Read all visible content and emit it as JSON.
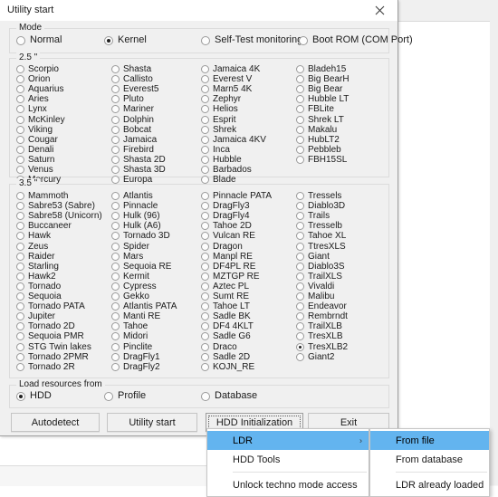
{
  "background": {
    "toolbar_glyphs": [
      "▮▮",
      "▦",
      "▬"
    ]
  },
  "dialog": {
    "title": "Utility start",
    "close_icon": "close-icon"
  },
  "mode_group": {
    "label": "Mode",
    "options": [
      {
        "label": "Normal",
        "checked": false
      },
      {
        "label": "Kernel",
        "checked": true
      },
      {
        "label": "Self-Test monitoring",
        "checked": false
      },
      {
        "label": "Boot ROM (COM Port)",
        "checked": false
      }
    ]
  },
  "group_25": {
    "label": "2.5 \"",
    "columns": [
      [
        {
          "label": "Scorpio",
          "checked": false
        },
        {
          "label": "Orion",
          "checked": false
        },
        {
          "label": "Aquarius",
          "checked": false
        },
        {
          "label": "Aries",
          "checked": false
        },
        {
          "label": "Lynx",
          "checked": false
        },
        {
          "label": "McKinley",
          "checked": false
        },
        {
          "label": "Viking",
          "checked": false
        },
        {
          "label": "Cougar",
          "checked": false
        },
        {
          "label": "Denali",
          "checked": false
        },
        {
          "label": "Saturn",
          "checked": false
        },
        {
          "label": "Venus",
          "checked": false
        },
        {
          "label": "Mercury",
          "checked": false
        }
      ],
      [
        {
          "label": "Shasta",
          "checked": false
        },
        {
          "label": "Callisto",
          "checked": false
        },
        {
          "label": "Everest5",
          "checked": false
        },
        {
          "label": "Pluto",
          "checked": false
        },
        {
          "label": "Mariner",
          "checked": false
        },
        {
          "label": "Dolphin",
          "checked": false
        },
        {
          "label": "Bobcat",
          "checked": false
        },
        {
          "label": "Jamaica",
          "checked": false
        },
        {
          "label": "Firebird",
          "checked": false
        },
        {
          "label": "Shasta 2D",
          "checked": false
        },
        {
          "label": "Shasta 3D",
          "checked": false
        },
        {
          "label": "Europa",
          "checked": false
        }
      ],
      [
        {
          "label": "Jamaica 4K",
          "checked": false
        },
        {
          "label": "Everest V",
          "checked": false
        },
        {
          "label": "Marn5 4K",
          "checked": false
        },
        {
          "label": "Zephyr",
          "checked": false
        },
        {
          "label": "Helios",
          "checked": false
        },
        {
          "label": "Esprit",
          "checked": false
        },
        {
          "label": "Shrek",
          "checked": false
        },
        {
          "label": "Jamaica 4KV",
          "checked": false
        },
        {
          "label": "Inca",
          "checked": false
        },
        {
          "label": "Hubble",
          "checked": false
        },
        {
          "label": "Barbados",
          "checked": false
        },
        {
          "label": "Blade",
          "checked": false
        }
      ],
      [
        {
          "label": "Bladeh15",
          "checked": false
        },
        {
          "label": "Big BearH",
          "checked": false
        },
        {
          "label": "Big Bear",
          "checked": false
        },
        {
          "label": "Hubble LT",
          "checked": false
        },
        {
          "label": "FBLite",
          "checked": false
        },
        {
          "label": "Shrek LT",
          "checked": false
        },
        {
          "label": "Makalu",
          "checked": false
        },
        {
          "label": "HubLT2",
          "checked": false
        },
        {
          "label": "Pebbleb",
          "checked": false
        },
        {
          "label": "FBH15SL",
          "checked": false
        }
      ]
    ]
  },
  "group_35": {
    "label": "3.5 \"",
    "columns": [
      [
        {
          "label": "Mammoth",
          "checked": false
        },
        {
          "label": "Sabre53 (Sabre)",
          "checked": false
        },
        {
          "label": "Sabre58 (Unicorn)",
          "checked": false
        },
        {
          "label": "Buccaneer",
          "checked": false
        },
        {
          "label": "Hawk",
          "checked": false
        },
        {
          "label": "Zeus",
          "checked": false
        },
        {
          "label": "Raider",
          "checked": false
        },
        {
          "label": "Starling",
          "checked": false
        },
        {
          "label": "Hawk2",
          "checked": false
        },
        {
          "label": "Tornado",
          "checked": false
        },
        {
          "label": "Sequoia",
          "checked": false
        },
        {
          "label": "Tornado PATA",
          "checked": false
        },
        {
          "label": "Jupiter",
          "checked": false
        },
        {
          "label": "Tornado 2D",
          "checked": false
        },
        {
          "label": "Sequoia PMR",
          "checked": false
        },
        {
          "label": "STG Twin lakes",
          "checked": false
        },
        {
          "label": "Tornado 2PMR",
          "checked": false
        },
        {
          "label": "Tornado 2R",
          "checked": false
        }
      ],
      [
        {
          "label": "Atlantis",
          "checked": false
        },
        {
          "label": "Pinnacle",
          "checked": false
        },
        {
          "label": "Hulk (96)",
          "checked": false
        },
        {
          "label": "Hulk (A6)",
          "checked": false
        },
        {
          "label": "Tornado 3D",
          "checked": false
        },
        {
          "label": "Spider",
          "checked": false
        },
        {
          "label": "Mars",
          "checked": false
        },
        {
          "label": "Sequoia RE",
          "checked": false
        },
        {
          "label": "Kermit",
          "checked": false
        },
        {
          "label": "Cypress",
          "checked": false
        },
        {
          "label": "Gekko",
          "checked": false
        },
        {
          "label": "Atlantis PATA",
          "checked": false
        },
        {
          "label": "Manti RE",
          "checked": false
        },
        {
          "label": "Tahoe",
          "checked": false
        },
        {
          "label": "Midori",
          "checked": false
        },
        {
          "label": "Pinclite",
          "checked": false
        },
        {
          "label": "DragFly1",
          "checked": false
        },
        {
          "label": "DragFly2",
          "checked": false
        }
      ],
      [
        {
          "label": "Pinnacle PATA",
          "checked": false
        },
        {
          "label": "DragFly3",
          "checked": false
        },
        {
          "label": "DragFly4",
          "checked": false
        },
        {
          "label": "Tahoe 2D",
          "checked": false
        },
        {
          "label": "Vulcan RE",
          "checked": false
        },
        {
          "label": "Dragon",
          "checked": false
        },
        {
          "label": "Manpl RE",
          "checked": false
        },
        {
          "label": "DF4PL RE",
          "checked": false
        },
        {
          "label": "MZTGP RE",
          "checked": false
        },
        {
          "label": "Aztec PL",
          "checked": false
        },
        {
          "label": "Sumt RE",
          "checked": false
        },
        {
          "label": "Tahoe LT",
          "checked": false
        },
        {
          "label": "Sadle BK",
          "checked": false
        },
        {
          "label": "DF4 4KLT",
          "checked": false
        },
        {
          "label": "Sadle G6",
          "checked": false
        },
        {
          "label": "Draco",
          "checked": false
        },
        {
          "label": "Sadle 2D",
          "checked": false
        },
        {
          "label": "KOJN_RE",
          "checked": false
        }
      ],
      [
        {
          "label": "Tressels",
          "checked": false
        },
        {
          "label": "Diablo3D",
          "checked": false
        },
        {
          "label": "Trails",
          "checked": false
        },
        {
          "label": "Tresselb",
          "checked": false
        },
        {
          "label": "Tahoe XL",
          "checked": false
        },
        {
          "label": "TtresXLS",
          "checked": false
        },
        {
          "label": "Giant",
          "checked": false
        },
        {
          "label": "Diablo3S",
          "checked": false
        },
        {
          "label": "TrailXLS",
          "checked": false
        },
        {
          "label": "Vivaldi",
          "checked": false
        },
        {
          "label": "Malibu",
          "checked": false
        },
        {
          "label": "Endeavor",
          "checked": false
        },
        {
          "label": "Rembrndt",
          "checked": false
        },
        {
          "label": "TrailXLB",
          "checked": false
        },
        {
          "label": "TresXLB",
          "checked": false
        },
        {
          "label": "TresXLB2",
          "checked": true
        },
        {
          "label": "Giant2",
          "checked": false
        }
      ]
    ]
  },
  "load_group": {
    "label": "Load resources from",
    "options": [
      {
        "label": "HDD",
        "checked": true
      },
      {
        "label": "Profile",
        "checked": false
      },
      {
        "label": "Database",
        "checked": false
      }
    ]
  },
  "buttons": [
    {
      "label": "Autodetect",
      "focused": false
    },
    {
      "label": "Utility start",
      "focused": false
    },
    {
      "label": "HDD Initialization",
      "focused": true
    },
    {
      "label": "Exit",
      "focused": false
    }
  ],
  "context_menu": {
    "items": [
      {
        "label": "LDR",
        "highlight": true,
        "submenu_arrow": "›",
        "separator_after": false
      },
      {
        "label": "HDD Tools",
        "highlight": false,
        "submenu_arrow": "",
        "separator_after": true
      },
      {
        "label": "Unlock techno mode access",
        "highlight": false,
        "submenu_arrow": "",
        "separator_after": false
      }
    ]
  },
  "submenu": {
    "items": [
      {
        "label": "From file",
        "highlight": true,
        "separator_after": false
      },
      {
        "label": "From database",
        "highlight": false,
        "separator_after": true
      },
      {
        "label": "LDR already loaded",
        "highlight": false,
        "separator_after": false
      }
    ]
  },
  "colors": {
    "dialog_face": "#f0f0f0",
    "menu_highlight": "#63b4ef",
    "group_border": "#dcdcdc"
  }
}
